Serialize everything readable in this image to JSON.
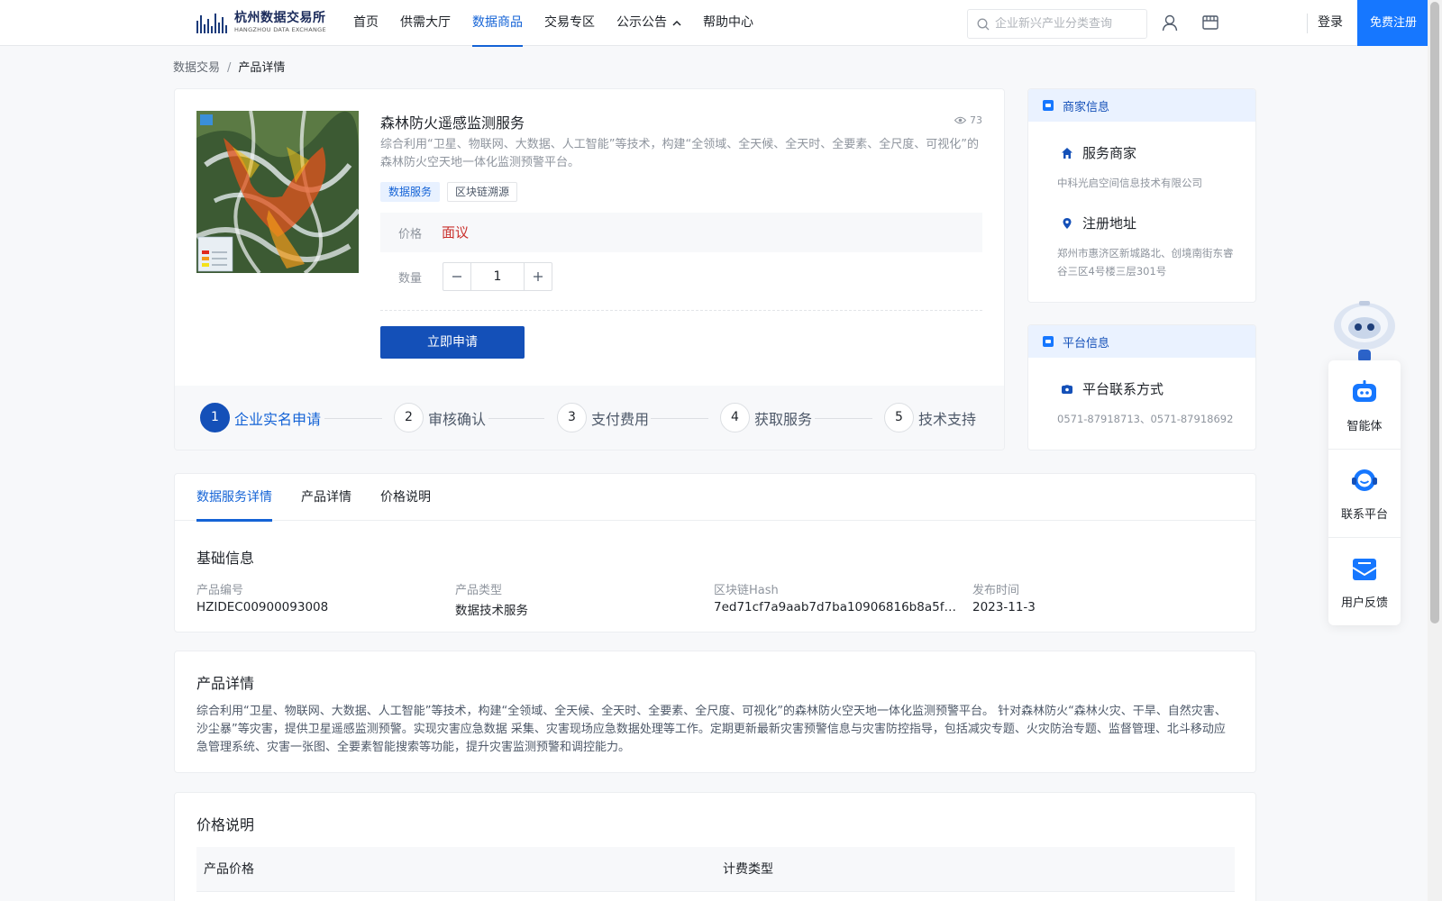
{
  "header": {
    "logo_cn": "杭州数据交易所",
    "logo_en": "HANGZHOU DATA EXCHANGE",
    "nav": [
      {
        "label": "首页"
      },
      {
        "label": "供需大厅"
      },
      {
        "label": "数据商品",
        "active": true
      },
      {
        "label": "交易专区"
      },
      {
        "label": "公示公告",
        "has_dropdown": true
      },
      {
        "label": "帮助中心"
      }
    ],
    "search_placeholder": "企业新兴产业分类查询",
    "login_label": "登录",
    "register_label": "免费注册",
    "accent_color": "#1677ff"
  },
  "breadcrumb": {
    "parent": "数据交易",
    "separator": "/",
    "current": "产品详情"
  },
  "product": {
    "title": "森林防火遥感监测服务",
    "views": "73",
    "description": "综合利用“卫星、物联网、大数据、人工智能”等技术，构建“全领域、全天候、全天时、全要素、全尺度、可视化”的森林防火空天地一体化监测预警平台。",
    "tags": [
      "数据服务",
      "区块链溯源"
    ],
    "price_label": "价格",
    "price_value": "面议",
    "quantity_label": "数量",
    "quantity_value": "1",
    "apply_label": "立即申请",
    "image_legend_title": "图例"
  },
  "process_steps": [
    {
      "num": "1",
      "label": "企业实名申请",
      "active": true
    },
    {
      "num": "2",
      "label": "审核确认"
    },
    {
      "num": "3",
      "label": "支付费用"
    },
    {
      "num": "4",
      "label": "获取服务"
    },
    {
      "num": "5",
      "label": "技术支持"
    }
  ],
  "merchant_panel": {
    "title": "商家信息",
    "merchant_label": "服务商家",
    "merchant_value": "中科光启空间信息技术有限公司",
    "address_label": "注册地址",
    "address_value": "郑州市惠济区新城路北、创境南街东睿谷三区4号楼三层301号"
  },
  "platform_panel": {
    "title": "平台信息",
    "contact_label": "平台联系方式",
    "contact_value": "0571-87918713、0571-87918692"
  },
  "float_widgets": [
    {
      "label": "智能体",
      "icon": "robot-icon"
    },
    {
      "label": "联系平台",
      "icon": "headset-icon"
    },
    {
      "label": "用户反馈",
      "icon": "feedback-icon"
    }
  ],
  "detail_tabs": [
    {
      "label": "数据服务详情",
      "active": true
    },
    {
      "label": "产品详情"
    },
    {
      "label": "价格说明"
    }
  ],
  "basic_info": {
    "title": "基础信息",
    "fields": [
      {
        "label": "产品编号",
        "value": "HZIDEC00900093008"
      },
      {
        "label": "产品类型",
        "value": "数据技术服务"
      },
      {
        "label": "区块链Hash",
        "value": "7ed71cf7a9aab7d7ba10906816b8a5f2ce5…"
      },
      {
        "label": "发布时间",
        "value": "2023-11-3"
      }
    ]
  },
  "product_detail": {
    "title": "产品详情",
    "text": "综合利用“卫星、物联网、大数据、人工智能”等技术，构建“全领域、全天候、全天时、全要素、全尺度、可视化”的森林防火空天地一体化监测预警平台。 针对森林防火“森林火灾、干旱、自然灾害、沙尘暴”等灾害，提供卫星遥感监测预警。实现灾害应急数据 采集、灾害现场应急数据处理等工作。定期更新最新灾害预警信息与灾害防控指导，包括减灾专题、火灾防治专题、监督管理、北斗移动应急管理系统、灾害一张图、全要素智能搜索等功能，提升灾害监测预警和调控能力。"
  },
  "price_section": {
    "title": "价格说明",
    "columns": [
      "产品价格",
      "计费类型"
    ]
  }
}
